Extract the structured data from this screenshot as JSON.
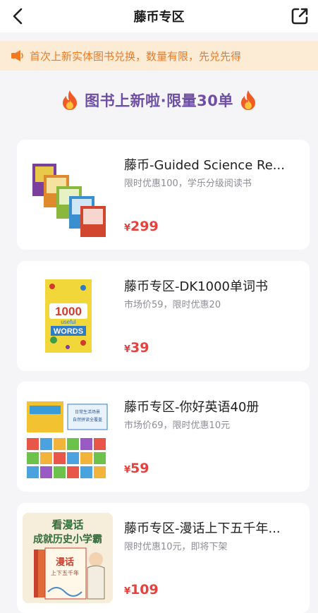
{
  "nav": {
    "title": "藤币专区",
    "back_icon": "chevron-left-icon",
    "share_icon": "share-external-icon"
  },
  "notice": {
    "icon": "speaker-icon",
    "text": "首次上新实体图书兑换，数量有限，先兑先得"
  },
  "banner": {
    "title": "图书上新啦·限量30单",
    "icon": "fire-icon"
  },
  "products": [
    {
      "title": "藤币-Guided Science Re...",
      "subtitle": "限时优惠100，学乐分级阅读书",
      "currency": "¥",
      "price": "299"
    },
    {
      "title": "藤币专区-DK1000单词书",
      "subtitle": "市场价59，限时优惠20",
      "currency": "¥",
      "price": "39",
      "cover_text": {
        "line1": "1000",
        "line2": "useful",
        "line3": "WORDS"
      }
    },
    {
      "title": "藤币专区-你好英语40册",
      "subtitle": "市场价69，限时优惠10元",
      "currency": "¥",
      "price": "59",
      "cover_text": {
        "line1": "日常生活场景",
        "line2": "自然拼读全覆盖"
      }
    },
    {
      "title": "藤币专区-漫话上下五千年...",
      "subtitle": "限时优惠10元，即将下架",
      "currency": "¥",
      "price": "109",
      "cover_text": {
        "line1": "看漫话",
        "line2": "成就历史小学霸",
        "line3": "漫话",
        "line4": "上下五千年"
      }
    }
  ],
  "colors": {
    "accent_price": "#e8413d",
    "notice_bg": "#fcebd5",
    "notice_text": "#f07a22",
    "banner_text": "#6f4fa6"
  }
}
